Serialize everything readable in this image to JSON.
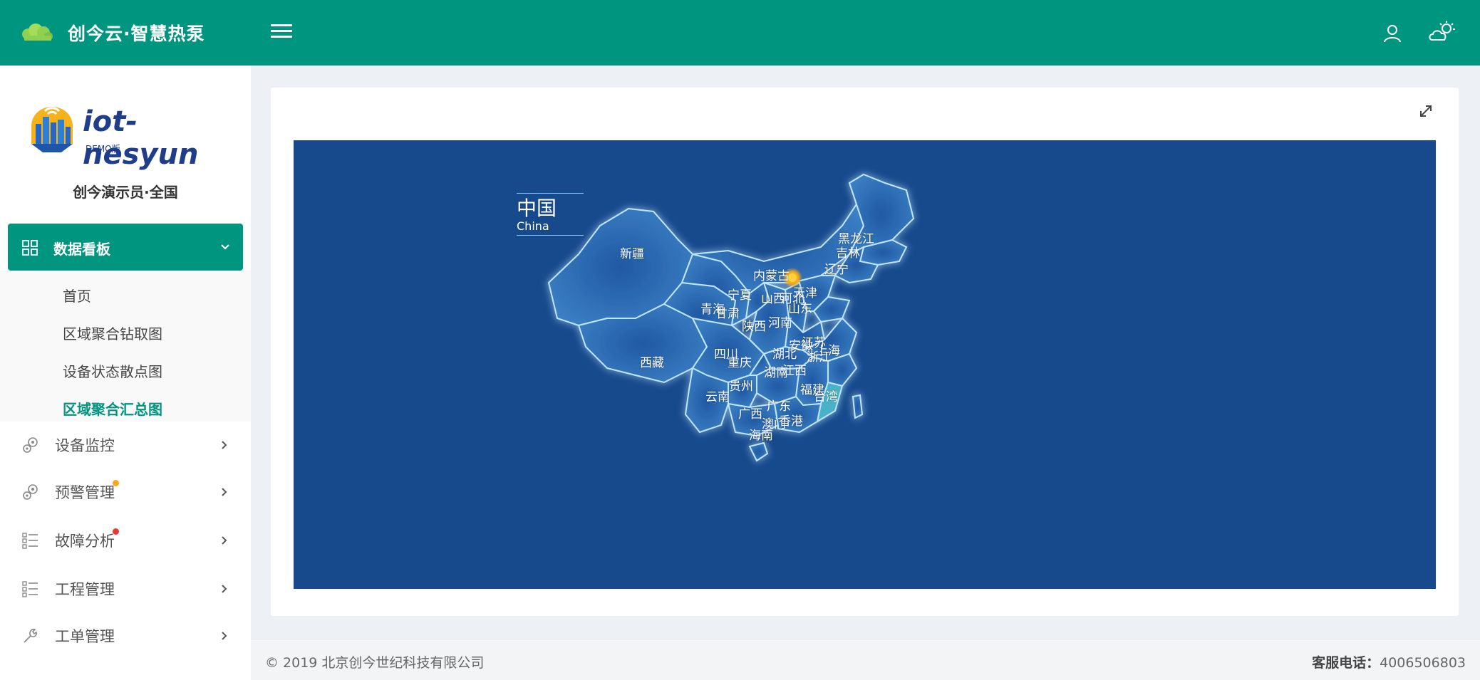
{
  "header": {
    "title": "创今云·智慧热泵",
    "brand_icon": "cloud-leaf-icon",
    "menu_icon": "hamburger-icon",
    "user_icon": "user-icon",
    "weather_icon": "sun-cloud-icon",
    "accent_color": "#00957f"
  },
  "sidebar": {
    "logo_text": "iot-nesyun",
    "logo_sub": "DEMO版",
    "org_name": "创今演示员·全国",
    "active_section": {
      "label": "数据看板",
      "icon": "dashboard-grid-icon",
      "expanded": true,
      "children": [
        {
          "label": "首页",
          "current": false
        },
        {
          "label": "区域聚合钻取图",
          "current": false
        },
        {
          "label": "设备状态散点图",
          "current": false
        },
        {
          "label": "区域聚合汇总图",
          "current": true
        }
      ]
    },
    "items": [
      {
        "label": "设备监控",
        "icon": "gears-icon",
        "badge_color": ""
      },
      {
        "label": "预警管理",
        "icon": "gears-icon",
        "badge_color": "#f5a623"
      },
      {
        "label": "故障分析",
        "icon": "checklist-icon",
        "badge_color": "#e53935"
      },
      {
        "label": "工程管理",
        "icon": "checklist-icon",
        "badge_color": ""
      },
      {
        "label": "工单管理",
        "icon": "wrench-icon",
        "badge_color": ""
      }
    ]
  },
  "content": {
    "expand_icon": "expand-icon",
    "map": {
      "title_zh": "中国",
      "title_en": "China",
      "background": "#174a8d",
      "highlight_marker": "北京",
      "provinces": [
        "新疆",
        "西藏",
        "内蒙古",
        "黑龙江",
        "吉林",
        "辽宁",
        "宁夏",
        "青海",
        "甘肃",
        "陕西",
        "山西",
        "河北",
        "天津",
        "山东",
        "河南",
        "四川",
        "重庆",
        "湖北",
        "安徽",
        "江苏",
        "上海",
        "浙江",
        "湖南",
        "江西",
        "贵州",
        "云南",
        "广西",
        "广东",
        "福建",
        "台湾",
        "澳门",
        "香港",
        "海南"
      ]
    }
  },
  "footer": {
    "copyright": "© 2019 北京创今世纪科技有限公司",
    "hotline_label": "客服电话：",
    "hotline_number": "4006506803"
  }
}
